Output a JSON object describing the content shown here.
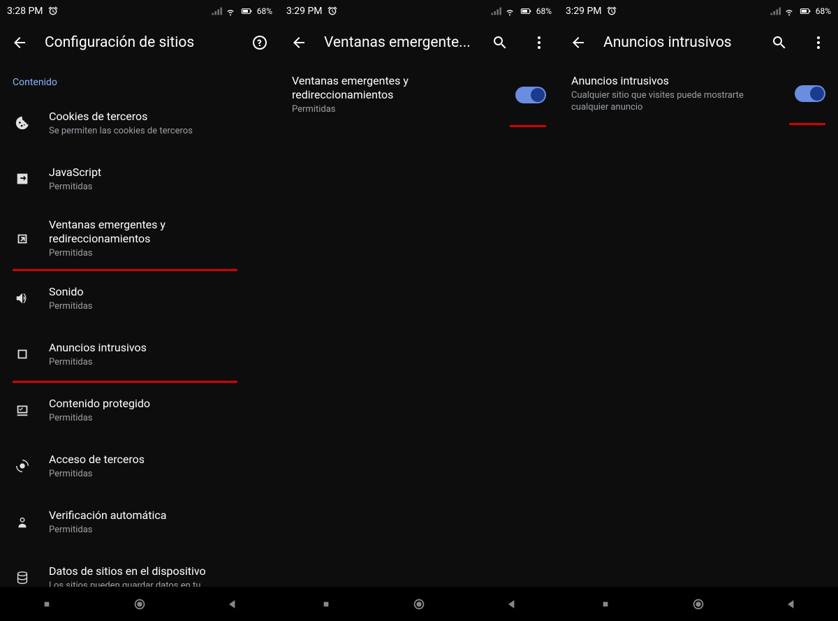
{
  "status": {
    "time": [
      "3:28 PM",
      "3:29 PM",
      "3:29 PM"
    ],
    "battery": "68%"
  },
  "pane0": {
    "title": "Configuración de sitios",
    "section": "Contenido",
    "items": [
      {
        "title": "Cookies de terceros",
        "sub": "Se permiten las cookies de terceros",
        "icon": "cookie"
      },
      {
        "title": "JavaScript",
        "sub": "Permitidas",
        "icon": "js"
      },
      {
        "title": "Ventanas emergentes y redireccionamientos",
        "sub": "Permitidas",
        "icon": "popup",
        "underline": true
      },
      {
        "title": "Sonido",
        "sub": "Permitidas",
        "icon": "sound"
      },
      {
        "title": "Anuncios intrusivos",
        "sub": "Permitidas",
        "icon": "ads",
        "underline": true
      },
      {
        "title": "Contenido protegido",
        "sub": "Permitidas",
        "icon": "protected"
      },
      {
        "title": "Acceso de terceros",
        "sub": "Permitidas",
        "icon": "access"
      },
      {
        "title": "Verificación automática",
        "sub": "Permitidas",
        "icon": "verify"
      },
      {
        "title": "Datos de sitios en el dispositivo",
        "sub": "Los sitios pueden guardar datos en tu",
        "icon": "data"
      }
    ]
  },
  "pane1": {
    "title": "Ventanas emergente...",
    "toggle": {
      "title": "Ventanas emergentes y redireccionamientos",
      "sub": "Permitidas",
      "on": true
    }
  },
  "pane2": {
    "title": "Anuncios intrusivos",
    "toggle": {
      "title": "Anuncios intrusivos",
      "sub": "Cualquier sitio que visites puede mostrarte cualquier anuncio",
      "on": true
    }
  }
}
